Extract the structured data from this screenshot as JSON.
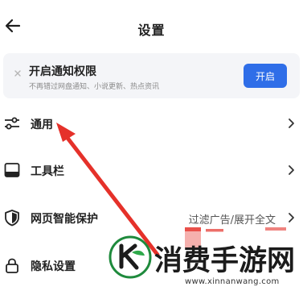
{
  "header": {
    "title": "设置"
  },
  "notification_banner": {
    "title": "开启通知权限",
    "subtitle": "不再错过网盘通知、小说更新、热点资讯",
    "button_label": "开启"
  },
  "settings": {
    "general": {
      "label": "通用"
    },
    "toolbar": {
      "label": "工具栏"
    },
    "smart_protection": {
      "label": "网页智能保护",
      "value": "过滤广告/展开全文"
    },
    "privacy": {
      "label": "隐私设置"
    }
  },
  "watermark": {
    "text": "消费手游网",
    "url": "www.xinnanwang.com"
  },
  "colors": {
    "accent": "#2f6ee8",
    "annotation_arrow": "#e5312a"
  }
}
